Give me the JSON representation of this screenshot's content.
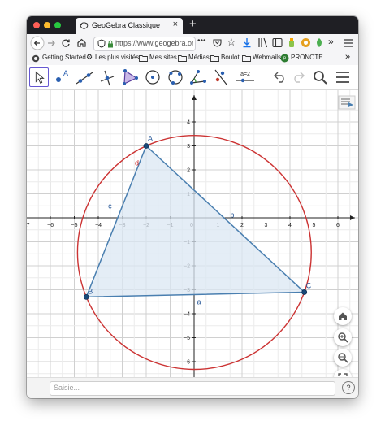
{
  "browser": {
    "tab_title": "GeoGebra Classique",
    "tab_close": "×",
    "new_tab": "+",
    "url": "https://www.geogebra.org",
    "bookmarks": [
      {
        "label": "Getting Started"
      },
      {
        "label": "Les plus visités"
      },
      {
        "label": "Mes sites"
      },
      {
        "label": "Médias"
      },
      {
        "label": "Boulot"
      },
      {
        "label": "Webmails"
      },
      {
        "label": "PRONOTE"
      }
    ],
    "overflow": "»"
  },
  "toolbar": {
    "tools": [
      "move-tool",
      "point-tool",
      "line-tool",
      "perpendicular-line-tool",
      "polygon-tool",
      "circle-center-point-tool",
      "circle-three-points-tool",
      "angle-tool",
      "reflect-tool",
      "slider-tool"
    ],
    "slider_label": "a=2"
  },
  "graphics": {
    "x_ticks": [
      "−7",
      "−6",
      "−5",
      "−4",
      "−3",
      "−2",
      "−1",
      "0",
      "1",
      "2",
      "3",
      "4",
      "5",
      "6"
    ],
    "y_ticks": [
      "4",
      "3",
      "2",
      "1",
      "−1",
      "−2",
      "−3",
      "−4",
      "−5",
      "−6",
      "−7"
    ],
    "points": {
      "A": [
        -2,
        3
      ],
      "B": [
        -4.5,
        -3.3
      ],
      "C": [
        4.6,
        -3.1
      ]
    },
    "labels": {
      "A": "A",
      "B": "B",
      "C": "C",
      "a": "a",
      "b": "b",
      "c": "c",
      "d": "d"
    },
    "colors": {
      "circle": "#cc3333",
      "triangle_stroke": "#4a7fb0",
      "triangle_fill": "#dbe7f3",
      "point": "#1a4a7a",
      "label": "#2a5a9a"
    }
  },
  "input": {
    "placeholder": "Saisie...",
    "help": "?"
  }
}
